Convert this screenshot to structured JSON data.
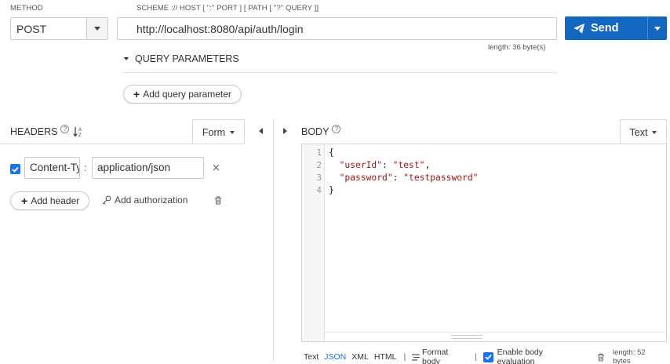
{
  "request": {
    "method_label": "METHOD",
    "method_value": "POST",
    "url_hint": "SCHEME :// HOST [ \":\" PORT ] [ PATH [ \"?\" QUERY ]]",
    "url_value": "http://localhost:8080/api/auth/login",
    "length_note": "length: 36 byte(s)",
    "send_label": "Send"
  },
  "query": {
    "title": "QUERY PARAMETERS",
    "add_label": "Add query parameter"
  },
  "headers": {
    "title": "HEADERS",
    "help": "?",
    "sort_icon_text": "↓A Z",
    "form_tab": "Form",
    "rows": [
      {
        "enabled": true,
        "name": "Content-Type",
        "value": "application/json"
      }
    ],
    "colon": ":",
    "add_header_label": "Add header",
    "add_auth_label": "Add authorization"
  },
  "body": {
    "title": "BODY",
    "help": "?",
    "text_tab": "Text",
    "line_numbers": [
      "1",
      "2",
      "3",
      "4"
    ],
    "code": {
      "line1": "{",
      "line2_key": "\"userId\"",
      "line2_colon": ": ",
      "line2_val": "\"test\"",
      "line2_comma": ",",
      "line3_key": "\"password\"",
      "line3_colon": ": ",
      "line3_val": "\"testpassword\"",
      "line4": "}"
    },
    "footer": {
      "modes": [
        "Text",
        "JSON",
        "XML",
        "HTML"
      ],
      "active_mode": "JSON",
      "separator": "|",
      "format_label": "Format body",
      "eval_label": "Enable body evaluation",
      "eval_enabled": true,
      "length": "length: 52 bytes"
    }
  },
  "colors": {
    "accent": "#1467c0",
    "checkbox": "#1a73e8",
    "string": "#a31515"
  }
}
